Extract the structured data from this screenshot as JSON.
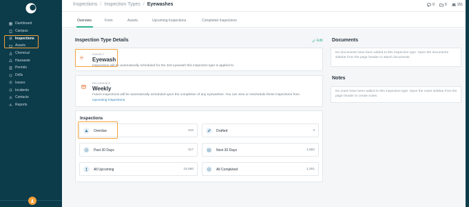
{
  "colors": {
    "sidebar_bg": "#0c3b4a",
    "accent_green": "#2fae8f",
    "highlight_orange": "#f5a13a",
    "link_blue": "#2d7fb5"
  },
  "sidebar": {
    "logo_icon": "crescent-logo-icon",
    "items": [
      {
        "label": "Dashboard",
        "icon": "dashboard-icon"
      },
      {
        "label": "Campus",
        "icon": "building-icon"
      },
      {
        "label": "Inspections",
        "icon": "checklist-icon",
        "active": true
      },
      {
        "label": "Assets",
        "icon": "box-icon"
      },
      {
        "label": "Chemical",
        "icon": "flask-icon"
      },
      {
        "label": "Hazwaste",
        "icon": "hazard-icon"
      },
      {
        "label": "Permits",
        "icon": "document-icon"
      },
      {
        "label": "Drills",
        "icon": "drill-icon"
      },
      {
        "label": "Issues",
        "icon": "warning-icon"
      },
      {
        "label": "Incidents",
        "icon": "incident-icon"
      },
      {
        "label": "Contacts",
        "icon": "contacts-icon"
      },
      {
        "label": "Reports",
        "icon": "report-icon"
      }
    ],
    "user_icon": "user-icon"
  },
  "header": {
    "breadcrumbs": [
      "Inspections",
      "Inspection Types",
      "Eyewashes"
    ],
    "actions": [
      {
        "icon": "comment-icon",
        "count": "0"
      },
      {
        "icon": "folder-icon",
        "count": "0"
      },
      {
        "icon": "team-icon",
        "count": "151"
      }
    ]
  },
  "tabs": [
    "Overview",
    "Form",
    "Assets",
    "Upcoming Inspections",
    "Completed Inspections"
  ],
  "details": {
    "title": "Inspection Type Details",
    "edit_label": "Edit",
    "subject": {
      "label": "SUBJECT",
      "value": "Eyewash",
      "description": "Inspections will be automatically scheduled for the 319 eyewash this inspection type is applied to."
    },
    "recurrence": {
      "label": "RECURRENCE",
      "value": "Weekly",
      "description": "Future inspections will be automatically scheduled upon the completion of any eyewashes. You can view or reschedule these inspections from",
      "link": "Upcoming Inspections."
    }
  },
  "inspections": {
    "title": "Inspections",
    "stats": [
      {
        "label": "Overdue",
        "count": "242",
        "icon": "warning-triangle-icon"
      },
      {
        "label": "Drafted",
        "count": "3",
        "icon": "pencil-icon"
      },
      {
        "label": "Past 30 Days",
        "count": "317",
        "icon": "check-circle-icon"
      },
      {
        "label": "Next 30 Days",
        "count": "1,582",
        "icon": "calendar-icon"
      },
      {
        "label": "All Upcoming",
        "count": "15,080",
        "icon": "hourglass-icon"
      },
      {
        "label": "All Completed",
        "count": "1,301",
        "icon": "check-circle-icon"
      }
    ]
  },
  "documents": {
    "title": "Documents",
    "empty_text": "No documents have been added to this inspection type. Open the documents sidebar from the page header to attach documents."
  },
  "notes": {
    "title": "Notes",
    "empty_text": "No notes have been added to this inspection type. Open the notes sidebar from the page header to create notes."
  }
}
